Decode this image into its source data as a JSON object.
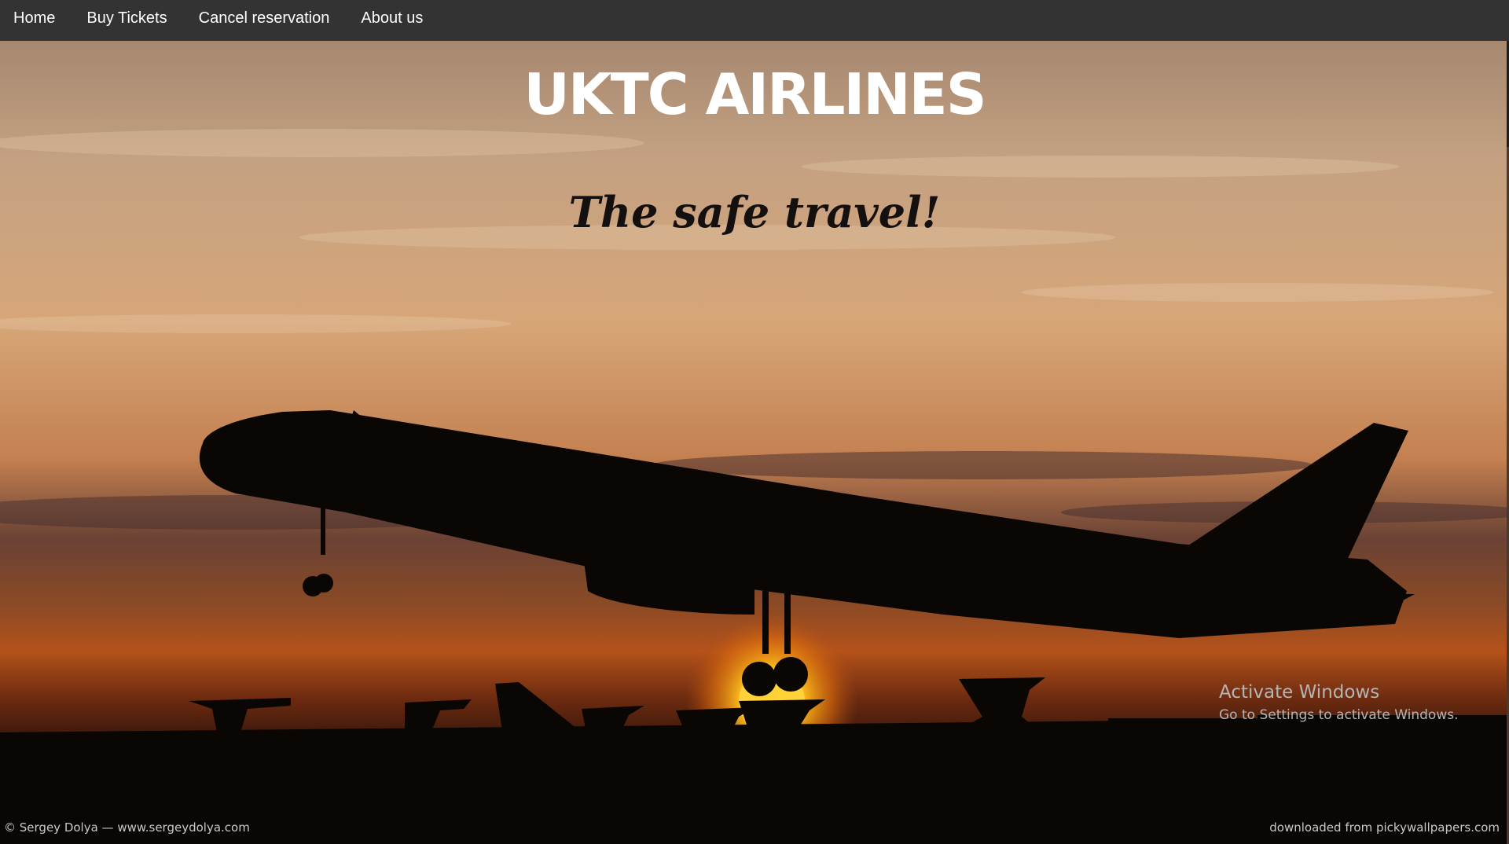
{
  "nav": {
    "items": [
      {
        "label": "Home"
      },
      {
        "label": "Buy Tickets"
      },
      {
        "label": "Cancel reservation"
      },
      {
        "label": "About us"
      }
    ]
  },
  "hero": {
    "title": "UKTC AIRLINES",
    "tagline": "The safe travel!",
    "photo_credit": "© Sergey Dolya — www.sergeydolya.com",
    "download_credit": "downloaded from pickywallpapers.com",
    "image": "airplane-takeoff-sunset-silhouette"
  },
  "watermark": {
    "title": "Activate Windows",
    "subtitle": "Go to Settings to activate Windows."
  },
  "colors": {
    "navbar": "#333333",
    "sky_top": "#b48c6c",
    "sky_mid": "#d4a06a",
    "horizon": "#b04a14",
    "sun": "#ffc020",
    "silhouette": "#0a0604"
  }
}
